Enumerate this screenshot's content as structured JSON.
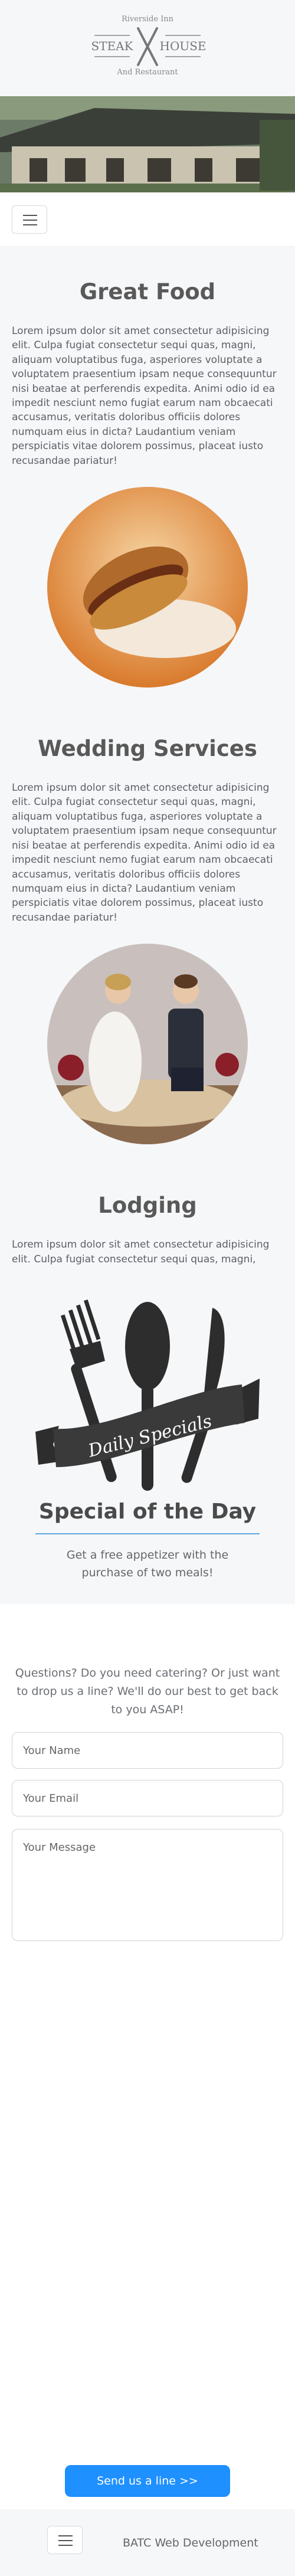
{
  "logo": {
    "top_text": "Riverside Inn",
    "left_word": "STEAK",
    "right_word": "HOUSE",
    "bottom_text": "And Restaurant"
  },
  "nav": {
    "menu_icon": "hamburger-icon"
  },
  "sections": [
    {
      "title": "Great Food",
      "body": "Lorem ipsum dolor sit amet consectetur adipisicing elit. Culpa fugiat consectetur sequi quas, magni, aliquam voluptatibus fuga, asperiores voluptate a voluptatem praesentium ipsam neque consequuntur nisi beatae at perferendis expedita. Animi odio id ea impedit nesciunt nemo fugiat earum nam obcaecati accusamus, veritatis doloribus officiis dolores numquam eius in dicta? Laudantium veniam perspiciatis vitae dolorem possimus, placeat iusto recusandae pariatur!"
    },
    {
      "title": "Wedding Services",
      "body": "Lorem ipsum dolor sit amet consectetur adipisicing elit. Culpa fugiat consectetur sequi quas, magni, aliquam voluptatibus fuga, asperiores voluptate a voluptatem praesentium ipsam neque consequuntur nisi beatae at perferendis expedita. Animi odio id ea impedit nesciunt nemo fugiat earum nam obcaecati accusamus, veritatis doloribus officiis dolores numquam eius in dicta? Laudantium veniam perspiciatis vitae dolorem possimus, placeat iusto recusandae pariatur!"
    },
    {
      "title": "Lodging",
      "body": "Lorem ipsum dolor sit amet consectetur adipisicing elit. Culpa fugiat consectetur sequi quas, magni, aliquam voluptatibus fuga, asperiores voluptate a voluptatem praesentium ipsam neque consequuntur nisi beatae at perferendis expedita. Animi odio id ea impedit nesciunt nemo fugiat earum nam obcaecati accusamus, veritatis doloribus officiis dolores numquam eius in dicta? Laudantium veniam perspiciatis vitae dolorem possimus, placeat iusto recusandae pariatur!"
    }
  ],
  "specials": {
    "banner_text": "Daily Specials",
    "title": "Special of the Day",
    "text": "Get a free appetizer with the purchase of two meals!"
  },
  "contact": {
    "intro": "Questions? Do you need catering? Or just want to drop us a line? We'll do our best to get back to you ASAP!",
    "name_placeholder": "Your Name",
    "email_placeholder": "Your Email",
    "message_placeholder": "Your Message",
    "submit_label": "Send us a line >>"
  },
  "footer": {
    "text": "BATC Web Development"
  },
  "colors": {
    "accent": "#1e90ff",
    "rule": "#5aa8e6",
    "page_bg": "#f6f7f9"
  }
}
